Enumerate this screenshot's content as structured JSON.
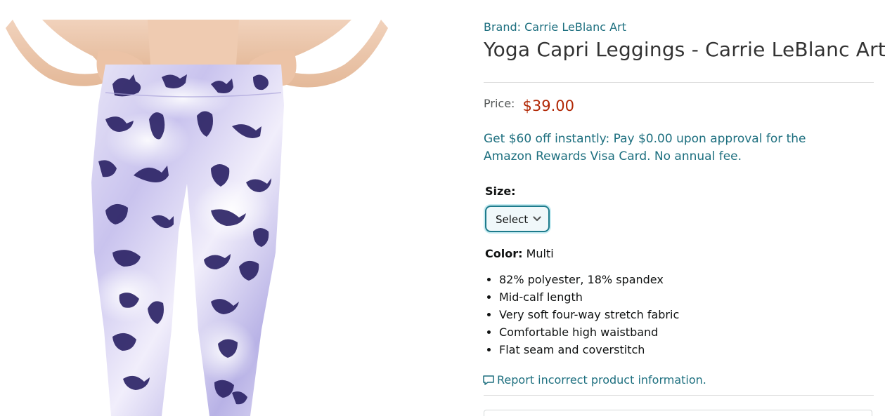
{
  "product": {
    "brand_link": "Brand: Carrie LeBlanc Art",
    "title": "Yoga Capri Leggings - Carrie LeBlanc Art",
    "image_icon": "product-photo-cat-print-leggings"
  },
  "price": {
    "label": "Price:",
    "value": "$39.00"
  },
  "promo": {
    "text": "Get $60 off instantly: Pay $0.00 upon approval for the Amazon Rewards Visa Card. No annual fee."
  },
  "size": {
    "label": "Size:",
    "selected": "Select",
    "chevron_icon": "chevron-down-icon"
  },
  "color": {
    "label": "Color:",
    "value": "Multi"
  },
  "features": [
    "82% polyester, 18% spandex",
    "Mid-calf length",
    "Very soft four-way stretch fabric",
    "Comfortable high waistband",
    "Flat seam and coverstitch"
  ],
  "report": {
    "text": "Report incorrect product information.",
    "icon": "speech-bubble-icon"
  },
  "colors": {
    "link": "#1d6f7f",
    "price": "#b12704",
    "title": "#333333",
    "select_border": "#1d7b8c"
  }
}
